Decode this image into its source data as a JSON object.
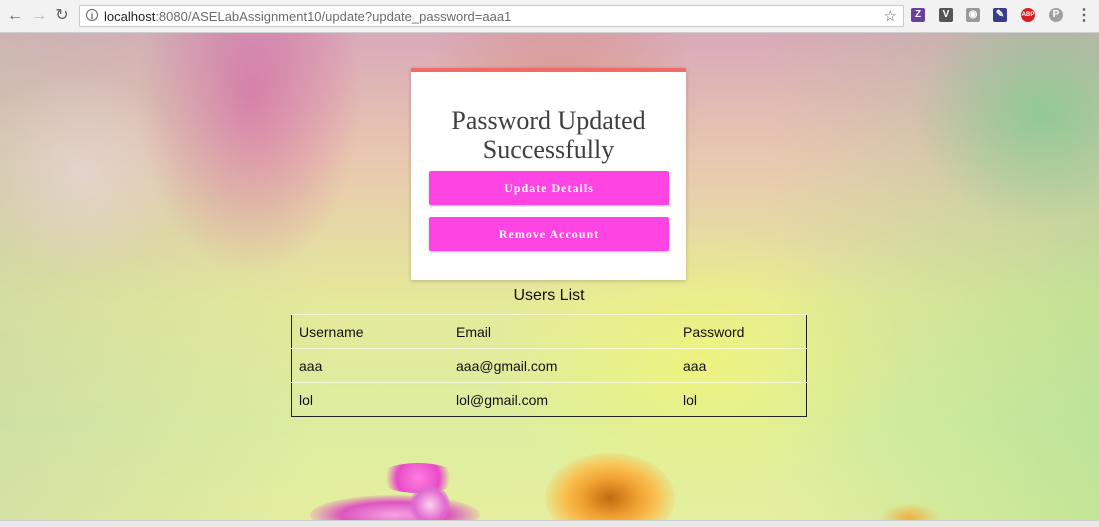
{
  "browser": {
    "url_host": "localhost",
    "url_rest": ":8080/ASELabAssignment10/update?update_password=aaa1",
    "extensions": [
      {
        "name": "zotero-icon",
        "glyph": "Z",
        "color": "#6a3fa0"
      },
      {
        "name": "shield-extension-icon",
        "glyph": "V",
        "color": "#555555"
      },
      {
        "name": "camera-icon",
        "glyph": "◉",
        "color": "#9a9a9a"
      },
      {
        "name": "extension-icon",
        "glyph": "✎",
        "color": "#3c3c8c"
      },
      {
        "name": "adblock-plus-icon",
        "glyph": "ABP",
        "color": "#d42020"
      },
      {
        "name": "p-extension-icon",
        "glyph": "P",
        "color": "#a0a0a0"
      }
    ]
  },
  "card": {
    "title": "Password Updated Successfully",
    "update_button": "Update Details",
    "remove_button": "Remove Account",
    "accent_color": "#ff44e4"
  },
  "users": {
    "title": "Users List",
    "columns": [
      "Username",
      "Email",
      "Password"
    ],
    "rows": [
      [
        "aaa",
        "aaa@gmail.com",
        "aaa"
      ],
      [
        "lol",
        "lol@gmail.com",
        "lol"
      ]
    ]
  }
}
